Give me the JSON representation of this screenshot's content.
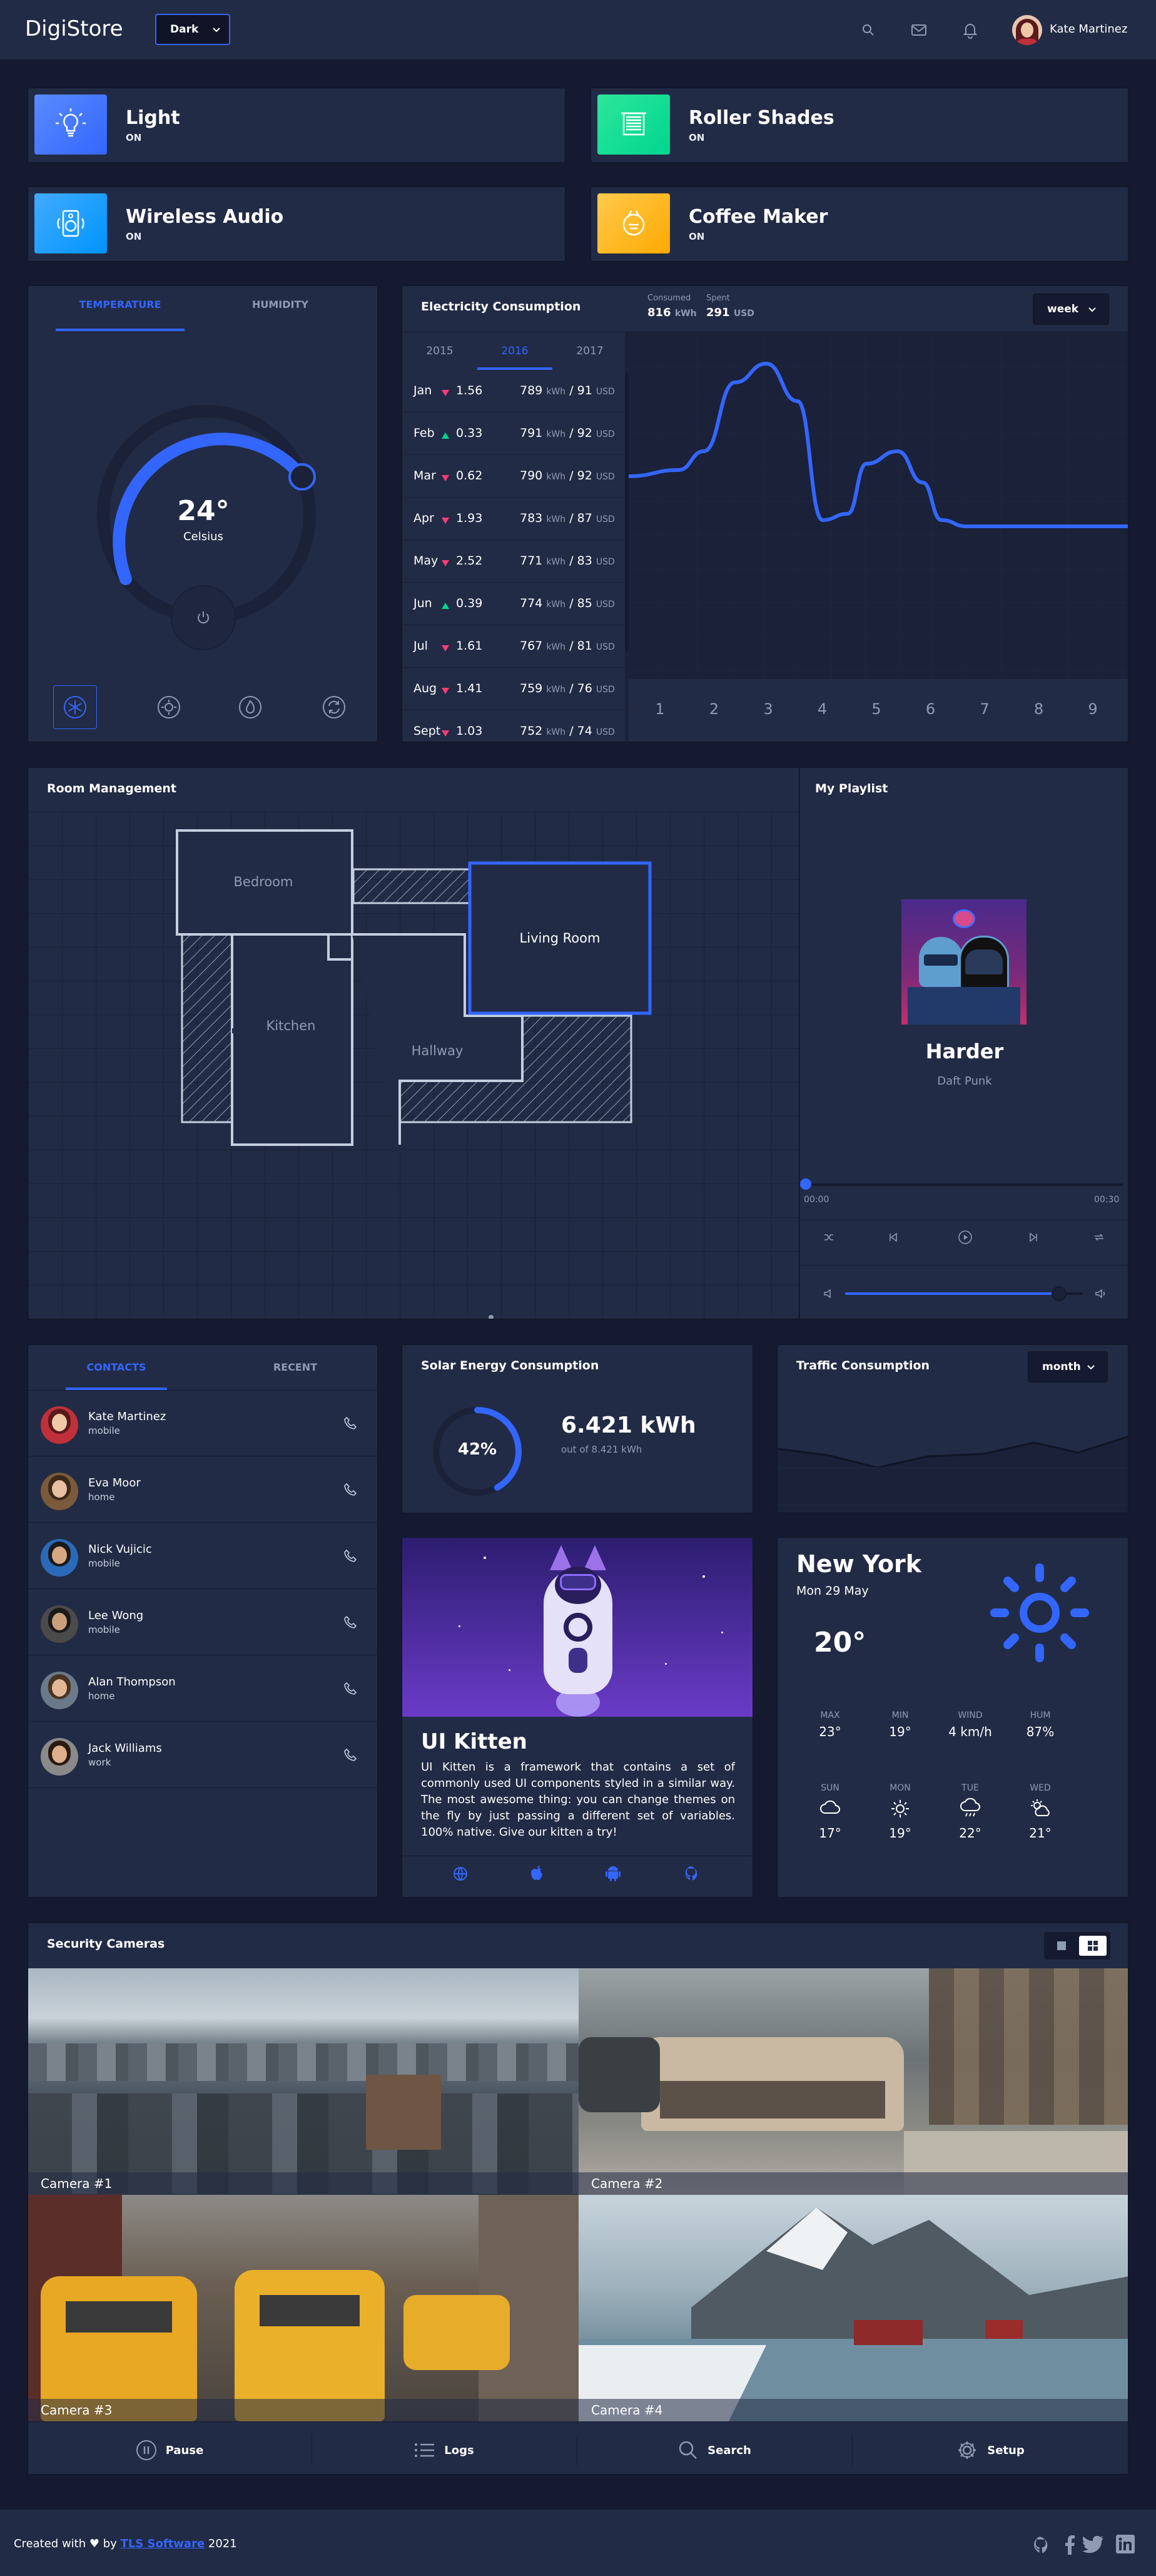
{
  "header": {
    "logo": "DigiStore",
    "theme": "Dark",
    "user_name": "Kate Martinez"
  },
  "status_cards": [
    {
      "title": "Light",
      "state": "ON"
    },
    {
      "title": "Roller Shades",
      "state": "ON"
    },
    {
      "title": "Wireless Audio",
      "state": "ON"
    },
    {
      "title": "Coffee Maker",
      "state": "ON"
    }
  ],
  "temperature": {
    "tabs": [
      "TEMPERATURE",
      "HUMIDITY"
    ],
    "value": "24°",
    "unit": "Celsius"
  },
  "electricity": {
    "title": "Electricity Consumption",
    "consumed_label": "Consumed",
    "consumed_value": "816",
    "consumed_unit": "kWh",
    "spent_label": "Spent",
    "spent_value": "291",
    "spent_unit": "USD",
    "period": "week",
    "years": [
      "2015",
      "2016",
      "2017"
    ],
    "rows": [
      {
        "month": "Jan",
        "delta": "1.56",
        "kwh": "789",
        "usd": "91",
        "trend": "down"
      },
      {
        "month": "Feb",
        "delta": "0.33",
        "kwh": "791",
        "usd": "92",
        "trend": "up"
      },
      {
        "month": "Mar",
        "delta": "0.62",
        "kwh": "790",
        "usd": "92",
        "trend": "down"
      },
      {
        "month": "Apr",
        "delta": "1.93",
        "kwh": "783",
        "usd": "87",
        "trend": "down"
      },
      {
        "month": "May",
        "delta": "2.52",
        "kwh": "771",
        "usd": "83",
        "trend": "down"
      },
      {
        "month": "Jun",
        "delta": "0.39",
        "kwh": "774",
        "usd": "85",
        "trend": "up"
      },
      {
        "month": "Jul",
        "delta": "1.61",
        "kwh": "767",
        "usd": "81",
        "trend": "down"
      },
      {
        "month": "Aug",
        "delta": "1.41",
        "kwh": "759",
        "usd": "76",
        "trend": "down"
      },
      {
        "month": "Sept",
        "delta": "1.03",
        "kwh": "752",
        "usd": "74",
        "trend": "down"
      }
    ],
    "kwh_unit": "kWh",
    "usd_unit": "USD",
    "separator": "/",
    "chart_x": [
      "1",
      "2",
      "3",
      "4",
      "5",
      "6",
      "7",
      "8",
      "9"
    ]
  },
  "room": {
    "title": "Room Management",
    "rooms": [
      "Bedroom",
      "Living Room",
      "Kitchen",
      "Hallway"
    ]
  },
  "playlist": {
    "title": "My Playlist",
    "song": "Harder",
    "artist": "Daft Punk",
    "time_current": "00:00",
    "time_total": "00:30",
    "progress": 0,
    "volume": 0.9
  },
  "contacts": {
    "tabs": [
      "CONTACTS",
      "RECENT"
    ],
    "items": [
      {
        "name": "Kate Martinez",
        "type": "mobile"
      },
      {
        "name": "Eva Moor",
        "type": "home"
      },
      {
        "name": "Nick Vujicic",
        "type": "mobile"
      },
      {
        "name": "Lee Wong",
        "type": "mobile"
      },
      {
        "name": "Alan Thompson",
        "type": "home"
      },
      {
        "name": "Jack Williams",
        "type": "work"
      }
    ]
  },
  "solar": {
    "title": "Solar Energy Consumption",
    "percent": "42%",
    "percent_value": 42,
    "value": "6.421 kWh",
    "sub": "out of 8.421 kWh"
  },
  "traffic": {
    "title": "Traffic Consumption",
    "period": "month"
  },
  "kitten": {
    "title": "UI Kitten",
    "text": "UI Kitten is a framework that contains a set of commonly used UI components styled in a similar way. The most awesome thing: you can change themes on the fly by just passing a different set of variables. 100% native. Give our kitten a try!"
  },
  "weather": {
    "city": "New York",
    "date": "Mon 29 May",
    "temp": "20°",
    "details": [
      {
        "label": "MAX",
        "value": "23°"
      },
      {
        "label": "MIN",
        "value": "19°"
      },
      {
        "label": "WIND",
        "value": "4 km/h"
      },
      {
        "label": "HUM",
        "value": "87%"
      }
    ],
    "forecast": [
      {
        "day": "SUN",
        "temp": "17°"
      },
      {
        "day": "MON",
        "temp": "19°"
      },
      {
        "day": "TUE",
        "temp": "22°"
      },
      {
        "day": "WED",
        "temp": "21°"
      }
    ]
  },
  "cameras": {
    "title": "Security Cameras",
    "items": [
      "Camera #1",
      "Camera #2",
      "Camera #3",
      "Camera #4"
    ],
    "actions": [
      "Pause",
      "Logs",
      "Search",
      "Setup"
    ]
  },
  "footer": {
    "prefix": "Created with ♥ by",
    "link": "TLS Software",
    "year": "2021"
  }
}
